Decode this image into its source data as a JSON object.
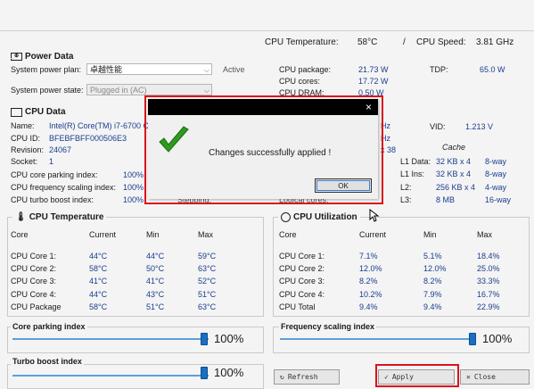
{
  "top": {
    "cpu_temp_label": "CPU Temperature:",
    "cpu_temp_value": "58°C",
    "separator": "/",
    "cpu_speed_label": "CPU Speed:",
    "cpu_speed_value": "3.81 GHz"
  },
  "power": {
    "title": "Power Data",
    "plan_label": "System power plan:",
    "plan_value": "卓越性能",
    "plan_status": "Active",
    "state_label": "System power state:",
    "state_value": "Plugged in (AC)",
    "package_label": "CPU package:",
    "package_value": "21.73 W",
    "cores_label": "CPU cores:",
    "cores_value": "17.72 W",
    "dram_label": "CPU DRAM:",
    "dram_value": "0.50 W",
    "tdp_label": "TDP:",
    "tdp_value": "65.0 W"
  },
  "cpu": {
    "title": "CPU Data",
    "name_label": "Name:",
    "name_value": "Intel(R) Core(TM) i7-6700 CP",
    "id_label": "CPU ID:",
    "id_value": "BFEBFBFF000506E3",
    "rev_label": "Revision:",
    "rev_value": "24067",
    "socket_label": "Socket:",
    "socket_value": "1",
    "parking_label": "CPU core parking index:",
    "parking_value": "100%",
    "freq_label": "CPU frequency scaling index:",
    "freq_value": "100%",
    "turbo_label": "CPU turbo boost index:",
    "turbo_value": "100%",
    "stepping_label": "Stepping:",
    "logical_label": "Logical cores:",
    "ghz1": "Hz",
    "ghz2": "Hz",
    "x38": "x 38",
    "vid_label": "VID:",
    "vid_value": "1.213 V",
    "cache_label": "Cache",
    "cache": [
      {
        "level": "L1 Data:",
        "size": "32 KB x 4",
        "ways": "8-way"
      },
      {
        "level": "L1 Ins:",
        "size": "32 KB x 4",
        "ways": "8-way"
      },
      {
        "level": "L2:",
        "size": "256 KB x 4",
        "ways": "4-way"
      },
      {
        "level": "L3:",
        "size": "8 MB",
        "ways": "16-way"
      }
    ]
  },
  "temp": {
    "title": "CPU Temperature",
    "headers": [
      "Core",
      "Current",
      "Min",
      "Max"
    ],
    "rows": [
      [
        "CPU Core 1:",
        "44°C",
        "44°C",
        "59°C"
      ],
      [
        "CPU Core 2:",
        "58°C",
        "50°C",
        "63°C"
      ],
      [
        "CPU Core 3:",
        "41°C",
        "41°C",
        "52°C"
      ],
      [
        "CPU Core 4:",
        "44°C",
        "43°C",
        "51°C"
      ],
      [
        "CPU Package",
        "58°C",
        "51°C",
        "63°C"
      ]
    ]
  },
  "util": {
    "title": "CPU Utilization",
    "headers": [
      "Core",
      "Current",
      "Min",
      "Max"
    ],
    "rows": [
      [
        "CPU Core 1:",
        "7.1%",
        "5.1%",
        "18.4%"
      ],
      [
        "CPU Core 2:",
        "12.0%",
        "12.0%",
        "25.0%"
      ],
      [
        "CPU Core 3:",
        "8.2%",
        "8.2%",
        "33.3%"
      ],
      [
        "CPU Core 4:",
        "10.2%",
        "7.9%",
        "16.7%"
      ],
      [
        "CPU Total",
        "9.4%",
        "9.4%",
        "22.9%"
      ]
    ]
  },
  "sliders": {
    "parking_title": "Core parking index",
    "parking_value": "100%",
    "parking_level": 1.0,
    "freq_title": "Frequency scaling index",
    "freq_value": "100%",
    "freq_level": 1.0,
    "turbo_title": "Turbo boost index",
    "turbo_value": "100%",
    "turbo_level": 1.0
  },
  "buttons": {
    "refresh": "Refresh",
    "apply": "Apply",
    "close": "Close"
  },
  "dialog": {
    "message": "Changes successfully applied !",
    "ok": "OK",
    "close_glyph": "×"
  },
  "colors": {
    "highlight": "#d8141b",
    "check": "#2e9a1f",
    "value_text": "#1a3d8f"
  }
}
